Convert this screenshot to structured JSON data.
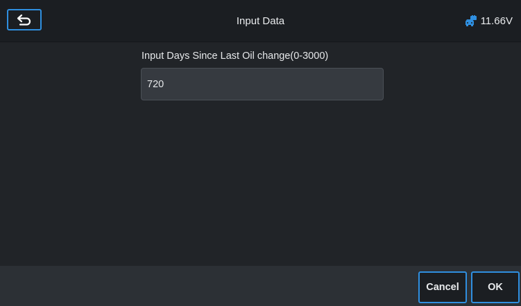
{
  "header": {
    "back_icon": "back-arrow-icon",
    "title": "Input Data",
    "battery_icon": "vehicle-battery-icon",
    "voltage": "11.66V"
  },
  "form": {
    "prompt": "Input Days Since Last Oil change(0-3000)",
    "value": "720"
  },
  "footer": {
    "cancel_label": "Cancel",
    "ok_label": "OK"
  },
  "colors": {
    "accent": "#2f8fe0",
    "background": "#212428",
    "topbar": "#1b1e22",
    "footer": "#2c3035",
    "input": "#363a40"
  }
}
